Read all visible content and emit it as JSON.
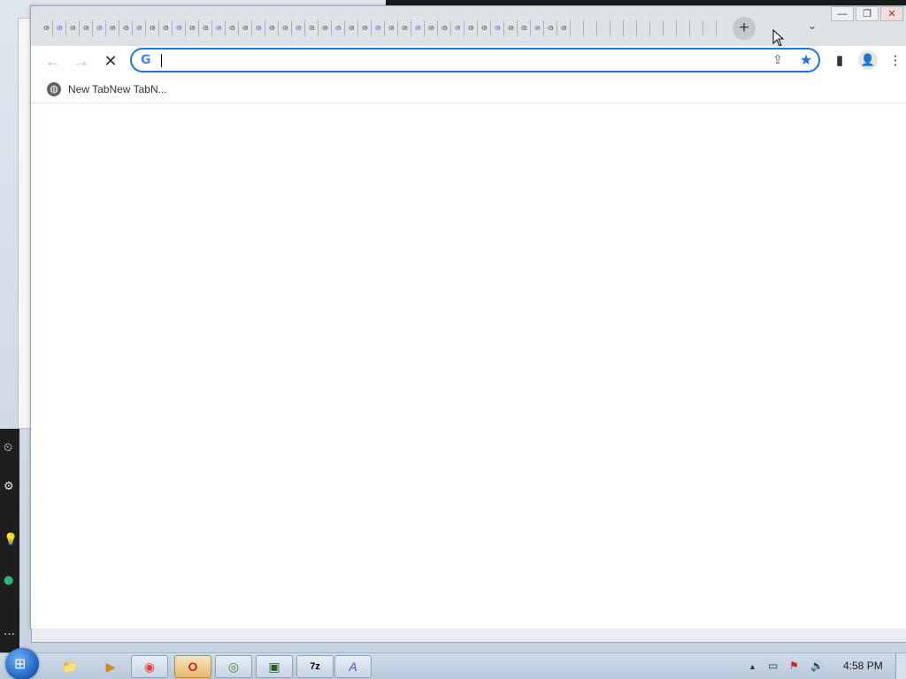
{
  "browser": {
    "tabs": [
      "ര",
      "ര",
      "ര",
      "ര",
      "ര",
      "ര",
      "ര",
      "ര",
      "ര",
      "ര",
      "ര",
      "ര",
      "ര",
      "ര",
      "ര",
      "ര",
      "ര",
      "ര",
      "ര",
      "ര",
      "ര",
      "ര",
      "ര",
      "ര",
      "ര",
      "ര",
      "ര",
      "ര",
      "ര",
      "ര",
      "ര",
      "ര",
      "ര",
      "ര",
      "ര",
      "ര",
      "ര",
      "ര",
      "ര",
      "ര",
      "",
      "",
      "",
      "",
      "",
      "",
      "",
      "",
      "",
      "",
      ""
    ],
    "new_tab_glyph": "+",
    "tab_search_glyph": "⌄",
    "window_controls": {
      "minimize": "—",
      "maximize": "❐",
      "close": "✕"
    },
    "toolbar": {
      "back_glyph": "←",
      "forward_glyph": "→",
      "stop_glyph": "✕",
      "omnibox": {
        "g_logo": "G",
        "value": "",
        "share_glyph": "⇪",
        "star_glyph": "★"
      },
      "side_panel_glyph": "▮",
      "profile_glyph": "👤",
      "menu_glyph": "⋮"
    },
    "bookmarks": [
      {
        "label": "New TabNew TabN...",
        "icon": "globe-icon"
      }
    ]
  },
  "taskbar": {
    "start_glyph": "⊞",
    "apps": [
      {
        "name": "explorer",
        "glyph": "📁"
      },
      {
        "name": "media-player",
        "glyph": "▶"
      },
      {
        "name": "chrome",
        "glyph": "◉"
      },
      {
        "name": "opera",
        "glyph": "O"
      },
      {
        "name": "chrome-alt",
        "glyph": "◎"
      },
      {
        "name": "network-app",
        "glyph": "▣"
      },
      {
        "name": "7zip",
        "glyph": "7z"
      },
      {
        "name": "font-app",
        "glyph": "A"
      }
    ],
    "tray": {
      "expand_glyph": "▲",
      "clock": "4:58 PM"
    }
  },
  "desktop": {
    "side_glyphs": [
      "⏲",
      "⚙",
      "💡",
      "●",
      "…"
    ]
  }
}
